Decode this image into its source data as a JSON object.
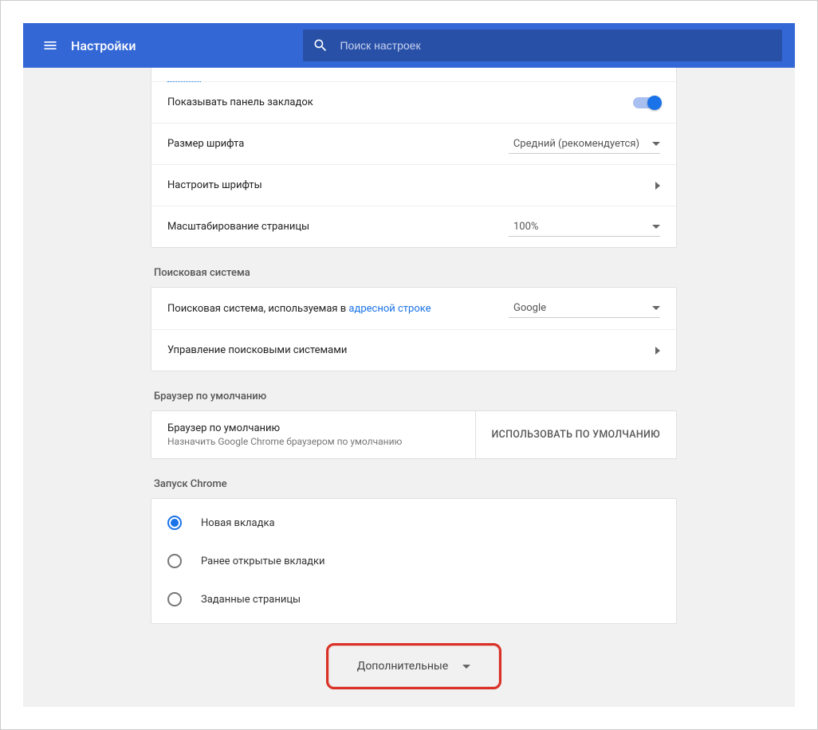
{
  "header": {
    "title": "Настройки",
    "search_placeholder": "Поиск настроек"
  },
  "appearance": {
    "truncated_top": "",
    "bookmarks_bar": "Показывать панель закладок",
    "font_size_label": "Размер шрифта",
    "font_size_value": "Средний (рекомендуется)",
    "customize_fonts": "Настроить шрифты",
    "page_zoom_label": "Масштабирование страницы",
    "page_zoom_value": "100%"
  },
  "search": {
    "section": "Поисковая система",
    "engine_label_prefix": "Поисковая система, используемая в ",
    "engine_label_link": "адресной строке",
    "engine_value": "Google",
    "manage": "Управление поисковыми системами"
  },
  "default_browser": {
    "section": "Браузер по умолчанию",
    "title": "Браузер по умолчанию",
    "subtitle": "Назначить Google Chrome браузером по умолчанию",
    "button": "ИСПОЛЬЗОВАТЬ ПО УМОЛЧАНИЮ"
  },
  "startup": {
    "section": "Запуск Chrome",
    "options": [
      {
        "label": "Новая вкладка",
        "checked": true
      },
      {
        "label": "Ранее открытые вкладки",
        "checked": false
      },
      {
        "label": "Заданные страницы",
        "checked": false
      }
    ]
  },
  "advanced": "Дополнительные"
}
